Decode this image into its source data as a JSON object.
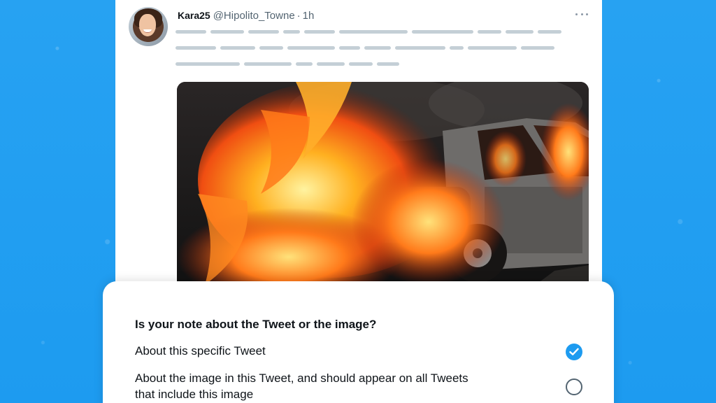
{
  "tweet": {
    "display_name": "Kara25",
    "handle": "@Hipolito_Towne",
    "separator": "·",
    "time": "1h"
  },
  "icons": {
    "avatar": "avatar-photo",
    "more": "more-icon",
    "image": "burning-car-image",
    "selected": "checkmark-icon",
    "unselected": "radio-empty-icon"
  },
  "dialog": {
    "question": "Is your note about the Tweet or the image?",
    "options": [
      {
        "label": "About this specific Tweet",
        "selected": true
      },
      {
        "label": "About the image in this Tweet, and should appear on all Tweets that include this image",
        "selected": false
      }
    ]
  },
  "colors": {
    "background": "#1d9bf0",
    "accent": "#1d9bf0",
    "redacted_text": "#c4cfd6"
  }
}
